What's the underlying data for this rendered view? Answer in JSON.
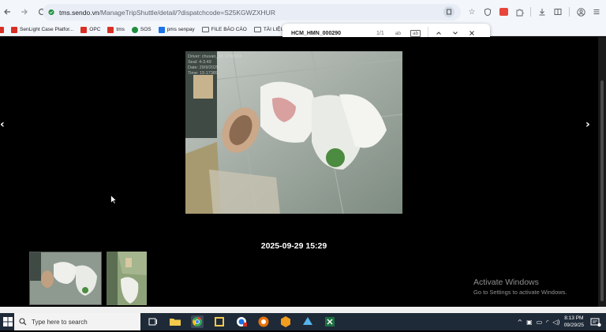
{
  "toolbar": {
    "back_icon": "arrow-left-icon",
    "forward_icon": "arrow-right-icon",
    "reload_icon": "reload-icon",
    "url_host": "tms.sendo.vn",
    "url_path": "/ManageTripShuttle/detail/?dispatchcode=S25KGWZXHUR"
  },
  "bookmarks": [
    {
      "label": "",
      "icon": "app-icon"
    },
    {
      "label": "SenLight Case Platfor...",
      "icon": "sendo-icon"
    },
    {
      "label": "OPC",
      "icon": "sendo-icon"
    },
    {
      "label": "tms",
      "icon": "sendo-icon"
    },
    {
      "label": "SOS",
      "icon": "sos-icon"
    },
    {
      "label": "pms senpay",
      "icon": "pms-icon"
    },
    {
      "label": "FILE BÁO CÁO",
      "icon": "folder-icon"
    },
    {
      "label": "TÀI LIỆU",
      "icon": "folder-icon"
    }
  ],
  "findbar": {
    "query": "HCM_HMN_000290",
    "count": "1/1",
    "opt_match_case": "ab",
    "opt_whole_word": "ab"
  },
  "viewer": {
    "timestamp": "2025-09-29 15:29",
    "photo_overlay": [
      "Driver: chuvan_38_IP80918",
      "Seal: 4-3.49",
      "Date: 29/9/2025",
      "Time: 15:17389"
    ]
  },
  "watermark": {
    "title": "Activate Windows",
    "subtitle": "Go to Settings to activate Windows."
  },
  "taskbar": {
    "search_placeholder": "Type here to search",
    "time": "8:13 PM",
    "date": "09/29/25"
  },
  "colors": {
    "background": "#000000",
    "taskbar": "#1f2a38",
    "findbar": "#ffffff"
  }
}
